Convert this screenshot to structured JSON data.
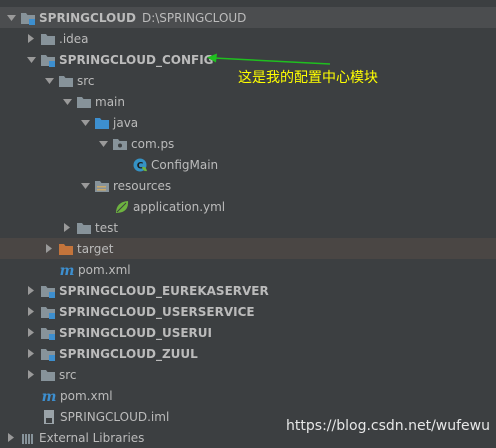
{
  "tree": {
    "rows": [
      {
        "label": "SPRINGCLOUD",
        "path": "D:\\SPRINGCLOUD",
        "bold": true
      },
      {
        "label": ".idea"
      },
      {
        "label": "SPRINGCLOUD_CONFIG",
        "bold": true
      },
      {
        "label": "src"
      },
      {
        "label": "main"
      },
      {
        "label": "java"
      },
      {
        "label": "com.ps"
      },
      {
        "label": "ConfigMain"
      },
      {
        "label": "resources"
      },
      {
        "label": "application.yml"
      },
      {
        "label": "test"
      },
      {
        "label": "target"
      },
      {
        "label": "pom.xml"
      },
      {
        "label": "SPRINGCLOUD_EUREKASERVER",
        "bold": true
      },
      {
        "label": "SPRINGCLOUD_USERSERVICE",
        "bold": true
      },
      {
        "label": "SPRINGCLOUD_USERUI",
        "bold": true
      },
      {
        "label": "SPRINGCLOUD_ZUUL",
        "bold": true
      },
      {
        "label": "src"
      },
      {
        "label": "pom.xml"
      },
      {
        "label": "SPRINGCLOUD.iml"
      },
      {
        "label": "External Libraries"
      }
    ]
  },
  "annotation": {
    "text": "这是我的配置中心模块"
  },
  "watermark": {
    "text": "https://blog.csdn.net/wufewu"
  },
  "colors": {
    "background": "#3c3f41",
    "text": "#bbbbbb",
    "folder": "#87939a",
    "source_folder": "#3d8fcf",
    "resource_folder": "#a88a5c",
    "excluded_folder": "#c4743b",
    "maven": "#3d8fcf",
    "spring": "#6db33f",
    "arrow": "#1fbf1f",
    "annotation": "#ffff00"
  },
  "icons": {
    "module": "module-folder-icon",
    "folder": "folder-icon",
    "source": "source-folder-icon",
    "package": "package-icon",
    "class": "spring-class-icon",
    "resources": "resources-folder-icon",
    "yml": "spring-leaf-icon",
    "target": "excluded-folder-icon",
    "maven": "maven-m-icon",
    "iml": "iml-file-icon",
    "libraries": "libraries-icon"
  }
}
